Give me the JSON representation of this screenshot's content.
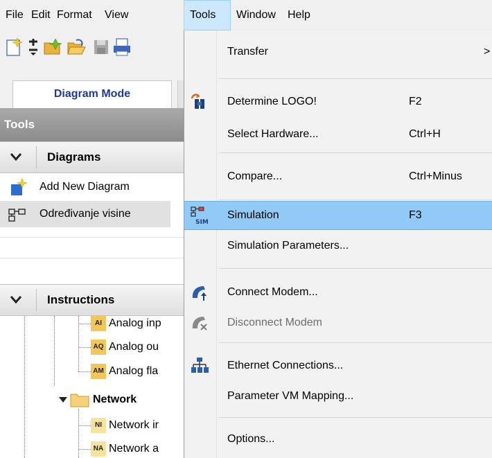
{
  "menubar": {
    "items": [
      {
        "label": "File"
      },
      {
        "label": "Edit"
      },
      {
        "label": "Format"
      },
      {
        "label": "View"
      },
      {
        "label": "Tools"
      },
      {
        "label": "Window"
      },
      {
        "label": "Help"
      }
    ],
    "active": "Tools"
  },
  "toolbar": {
    "icons": [
      "new-file-icon",
      "plus-minus-icon",
      "new-folder-icon",
      "open-folder-icon",
      "save-icon",
      "print-icon"
    ]
  },
  "tab": {
    "label": "Diagram Mode"
  },
  "tools_panel": {
    "header": "Tools",
    "diagrams_section": {
      "label": "Diagrams",
      "items": [
        {
          "label": "Add New Diagram",
          "icon": "add-diagram-icon"
        },
        {
          "label": "Određivanje visine",
          "icon": "diagram-icon",
          "selected": true
        }
      ]
    },
    "instructions_section": {
      "label": "Instructions",
      "items": [
        {
          "badge": "AI",
          "label": "Analog inp"
        },
        {
          "badge": "AQ",
          "label": "Analog ou"
        },
        {
          "badge": "AM",
          "label": "Analog fla"
        },
        {
          "label": "Network",
          "folder": true
        },
        {
          "badge": "NI",
          "label": "Network ir"
        },
        {
          "badge": "NA",
          "label": "Network a"
        }
      ]
    }
  },
  "tools_menu": {
    "items": [
      {
        "label": "Transfer",
        "shortcut": "",
        "submenu_arrow": ">"
      },
      {
        "label": "Determine LOGO!",
        "shortcut": "F2",
        "icon": "determine-logo-icon"
      },
      {
        "label": "Select Hardware...",
        "shortcut": "Ctrl+H"
      },
      {
        "label": "Compare...",
        "shortcut": "Ctrl+Minus"
      },
      {
        "label": "Simulation",
        "shortcut": "F3",
        "icon": "simulation-icon",
        "highlighted": true
      },
      {
        "label": "Simulation Parameters...",
        "shortcut": ""
      },
      {
        "label": "Connect Modem...",
        "shortcut": "",
        "icon": "connect-modem-icon"
      },
      {
        "label": "Disconnect Modem",
        "shortcut": "",
        "icon": "disconnect-modem-icon",
        "disabled": true
      },
      {
        "label": "Ethernet Connections...",
        "shortcut": "",
        "icon": "ethernet-icon"
      },
      {
        "label": "Parameter VM Mapping...",
        "shortcut": ""
      },
      {
        "label": "Options...",
        "shortcut": ""
      }
    ],
    "sim_badge": "SIM"
  },
  "colors": {
    "highlight": "#91c9f7",
    "active_menu": "#cce8ff",
    "tab_text": "#1f3a93",
    "badge": "#f3c65a"
  }
}
